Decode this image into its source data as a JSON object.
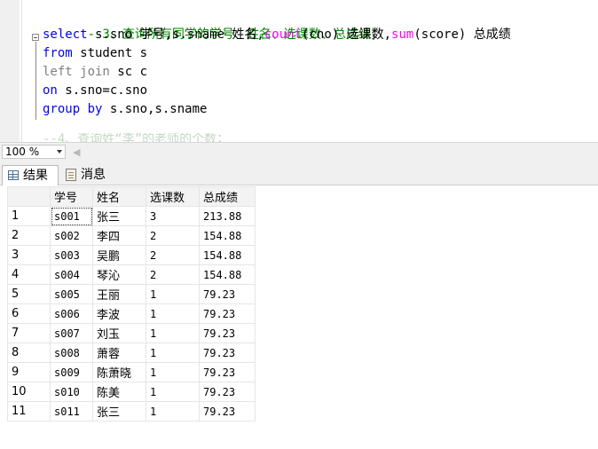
{
  "editor": {
    "comment": "--3、查询所有同学的学号、姓名、选课数、总成绩；",
    "line1": {
      "kw_select": "select",
      "p1": " s.sno 学号,s.sname 姓名,",
      "fn_count": "count",
      "p2": "(cno) 选课数,",
      "fn_sum": "sum",
      "p3": "(score) 总成绩"
    },
    "line2": {
      "kw": "from",
      "rest": " student s"
    },
    "line3": {
      "kw": "left join",
      "rest": " sc c"
    },
    "line4": {
      "kw": "on",
      "rest": " s.sno=c.sno"
    },
    "line5": {
      "kw": "group by",
      "rest": " s.sno,s.sname"
    },
    "ghost": "--4、查询姓“李”的老师的个数；"
  },
  "zoom": {
    "value": "100 %"
  },
  "tabs": {
    "results": "结果",
    "messages": "消息"
  },
  "grid": {
    "headers": [
      "学号",
      "姓名",
      "选课数",
      "总成绩"
    ],
    "rows": [
      [
        "1",
        "s001",
        "张三",
        "3",
        "213.88"
      ],
      [
        "2",
        "s002",
        "李四",
        "2",
        "154.88"
      ],
      [
        "3",
        "s003",
        "吴鹏",
        "2",
        "154.88"
      ],
      [
        "4",
        "s004",
        "琴沁",
        "2",
        "154.88"
      ],
      [
        "5",
        "s005",
        "王丽",
        "1",
        "79.23"
      ],
      [
        "6",
        "s006",
        "李波",
        "1",
        "79.23"
      ],
      [
        "7",
        "s007",
        "刘玉",
        "1",
        "79.23"
      ],
      [
        "8",
        "s008",
        "萧蓉",
        "1",
        "79.23"
      ],
      [
        "9",
        "s009",
        "陈萧晓",
        "1",
        "79.23"
      ],
      [
        "10",
        "s010",
        "陈美",
        "1",
        "79.23"
      ],
      [
        "11",
        "s011",
        "张三",
        "1",
        "79.23"
      ]
    ]
  }
}
